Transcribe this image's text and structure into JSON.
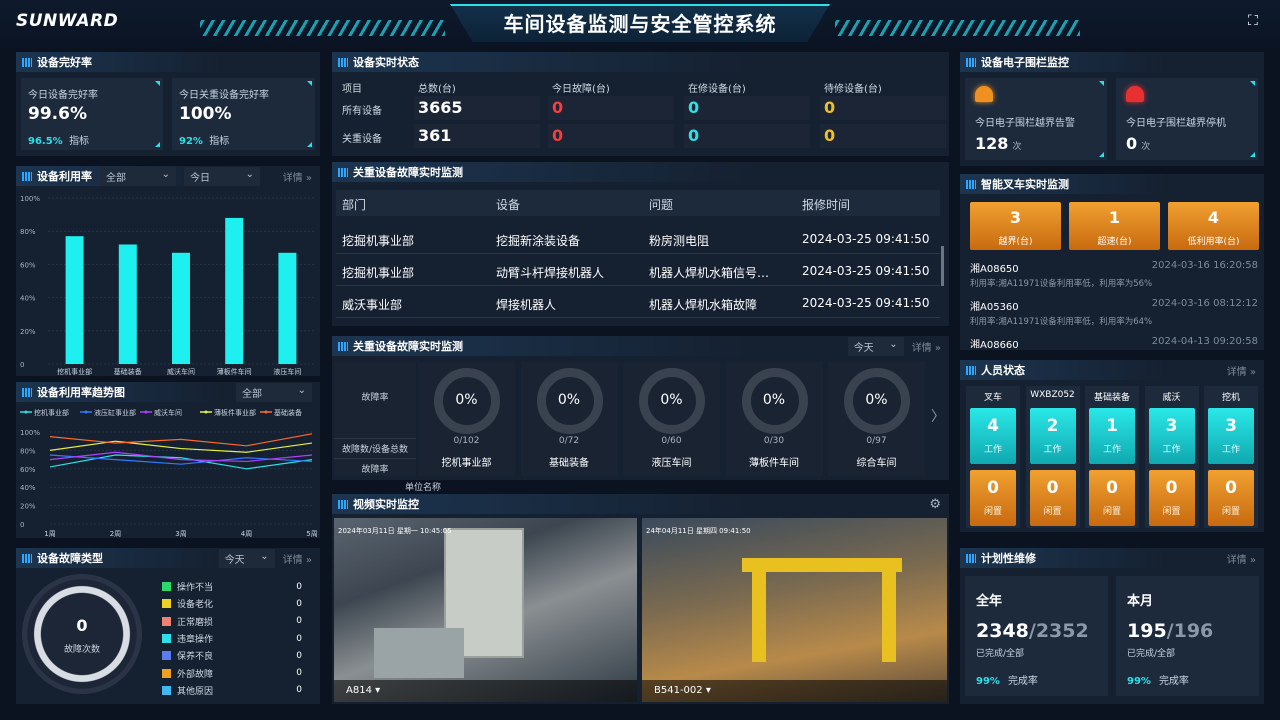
{
  "header": {
    "logo": "SUNWARD",
    "title": "车间设备监测与安全管控系统",
    "fullscreen_icon": "fullscreen-icon"
  },
  "completeness": {
    "title": "设备完好率",
    "cards": [
      {
        "label": "今日设备完好率",
        "value": "99.6%",
        "pct": "96.5%",
        "note": "指标"
      },
      {
        "label": "今日关重设备完好率",
        "value": "100%",
        "pct": "92%",
        "note": "指标"
      }
    ]
  },
  "utilization": {
    "title": "设备利用率",
    "filter1": "全部",
    "filter2": "今日",
    "more": "详情",
    "chart_data": {
      "type": "bar",
      "categories": [
        "挖机事业部",
        "基础装备",
        "威沃车间",
        "薄板件车间",
        "液压车间"
      ],
      "values": [
        77,
        72,
        67,
        88,
        67
      ],
      "yticks": [
        "100%",
        "80%",
        "60%",
        "40%",
        "20%",
        "0"
      ],
      "ylim": [
        0,
        100
      ]
    }
  },
  "trend": {
    "title": "设备利用率趋势图",
    "filter": "全部",
    "chart_data": {
      "type": "line",
      "categories": [
        "1周",
        "2周",
        "3周",
        "4周",
        "5周"
      ],
      "yticks": [
        "100%",
        "80%",
        "60%",
        "40%",
        "20%",
        "0"
      ],
      "series": [
        {
          "name": "挖机事业部",
          "color": "#2be0e8",
          "values": [
            62,
            75,
            72,
            60,
            70
          ]
        },
        {
          "name": "液压缸事业部",
          "color": "#2f7cff",
          "values": [
            75,
            70,
            65,
            72,
            68
          ]
        },
        {
          "name": "威沃车间",
          "color": "#b040ff",
          "values": [
            70,
            78,
            70,
            68,
            75
          ]
        },
        {
          "name": "薄板件事业部",
          "color": "#e8f040",
          "values": [
            80,
            90,
            82,
            78,
            88
          ]
        },
        {
          "name": "基础装备",
          "color": "#ff6a2a",
          "values": [
            95,
            88,
            92,
            85,
            98
          ]
        }
      ]
    }
  },
  "fault_type": {
    "title": "设备故障类型",
    "filter": "今天",
    "more": "详情",
    "count": "0",
    "count_label": "故障次数",
    "items": [
      {
        "label": "操作不当",
        "value": "0",
        "color": "#2ad96a"
      },
      {
        "label": "设备老化",
        "value": "0",
        "color": "#f0d020"
      },
      {
        "label": "正常磨损",
        "value": "0",
        "color": "#f08070"
      },
      {
        "label": "违章操作",
        "value": "0",
        "color": "#2be0e8"
      },
      {
        "label": "保养不良",
        "value": "0",
        "color": "#5a7cf0"
      },
      {
        "label": "外部故障",
        "value": "0",
        "color": "#f0a020"
      },
      {
        "label": "其他原因",
        "value": "0",
        "color": "#40b8f0"
      }
    ]
  },
  "realtime": {
    "title": "设备实时状态",
    "headers": [
      "项目",
      "总数(台)",
      "今日故障(台)",
      "在修设备(台)",
      "待修设备(台)"
    ],
    "rows": [
      {
        "name": "所有设备",
        "total": "3665",
        "fault": "0",
        "repairing": "0",
        "pending": "0"
      },
      {
        "name": "关重设备",
        "total": "361",
        "fault": "0",
        "repairing": "0",
        "pending": "0"
      }
    ]
  },
  "fault_monitor": {
    "title": "关重设备故障实时监测",
    "headers": [
      "部门",
      "设备",
      "问题",
      "报修时间"
    ],
    "rows": [
      [
        "挖掘机事业部",
        "挖掘新涂装设备",
        "粉房测电阻",
        "2024-03-25  09:41:50"
      ],
      [
        "挖掘机事业部",
        "动臂斗杆焊接机器人",
        "机器人焊机水箱信号…",
        "2024-03-25  09:41:50"
      ],
      [
        "威沃事业部",
        "焊接机器人",
        "机器人焊机水箱故障",
        "2024-03-25  09:41:50"
      ]
    ]
  },
  "fault_rate": {
    "title": "关重设备故障实时监测",
    "filter": "今天",
    "more": "详情",
    "row_labels": [
      "故障率",
      "故障数/设备总数",
      "故障率"
    ],
    "footer": "单位名称",
    "units": [
      {
        "pct": "0%",
        "ratio": "0/102",
        "name": "挖机事业部"
      },
      {
        "pct": "0%",
        "ratio": "0/72",
        "name": "基础装备"
      },
      {
        "pct": "0%",
        "ratio": "0/60",
        "name": "液压车间"
      },
      {
        "pct": "0%",
        "ratio": "0/30",
        "name": "薄板件车间"
      },
      {
        "pct": "0%",
        "ratio": "0/97",
        "name": "综合车间"
      }
    ]
  },
  "video": {
    "title": "视频实时监控",
    "cams": [
      {
        "name": "A814"
      },
      {
        "name": "B541-002"
      }
    ],
    "cam1_ts": "2024年03月11日  星期一  10:45:05",
    "cam2_ts": "24年04月11日 星期四 09:41:50"
  },
  "fence": {
    "title": "设备电子围栏监控",
    "cards": [
      {
        "label": "今日电子围栏越界告警",
        "value": "128",
        "unit": "次",
        "color": "#f09020"
      },
      {
        "label": "今日电子围栏越界停机",
        "value": "0",
        "unit": "次",
        "color": "#e83030"
      }
    ]
  },
  "forklift": {
    "title": "智能叉车实时监测",
    "stats": [
      {
        "value": "3",
        "label": "越界(台)"
      },
      {
        "value": "1",
        "label": "超速(台)"
      },
      {
        "value": "4",
        "label": "低利用率(台)"
      }
    ],
    "events": [
      {
        "id": "湘A08650",
        "time": "2024-03-16 16:20:58",
        "desc": "利用率:湘A11971设备利用率低，利用率为56%"
      },
      {
        "id": "湘A05360",
        "time": "2024-03-16 08:12:12",
        "desc": "利用率:湘A11971设备利用率低，利用率为64%"
      },
      {
        "id": "湘A08660",
        "time": "2024-04-13 09:20:58",
        "desc": ""
      }
    ]
  },
  "staff": {
    "title": "人员状态",
    "more": "详情",
    "cols": [
      {
        "name": "叉车",
        "work": "4",
        "idle": "0"
      },
      {
        "name": "WXBZ052",
        "work": "2",
        "idle": "0"
      },
      {
        "name": "基础装备",
        "work": "1",
        "idle": "0"
      },
      {
        "name": "威沃",
        "work": "3",
        "idle": "0"
      },
      {
        "name": "挖机",
        "work": "3",
        "idle": "0"
      }
    ],
    "work_label": "工作",
    "idle_label": "闲置"
  },
  "maintenance": {
    "title": "计划性维修",
    "more": "详情",
    "cards": [
      {
        "period": "全年",
        "done": "2348",
        "total": "/2352",
        "sub": "已完成/全部",
        "pct": "99%",
        "note": "完成率"
      },
      {
        "period": "本月",
        "done": "195",
        "total": "/196",
        "sub": "已完成/全部",
        "pct": "99%",
        "note": "完成率"
      }
    ]
  }
}
